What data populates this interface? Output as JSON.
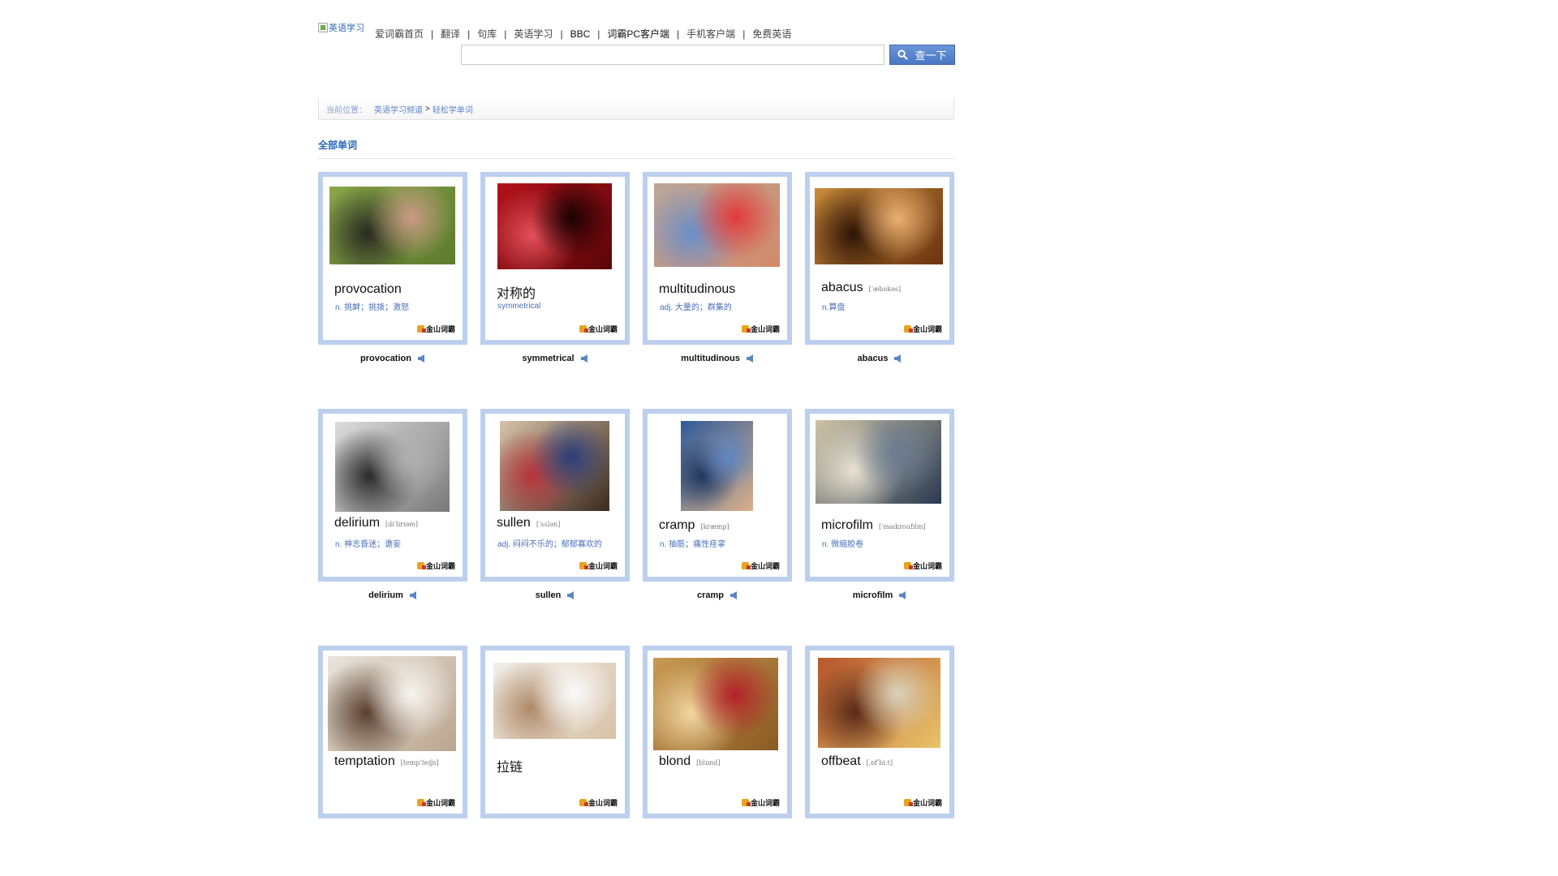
{
  "header": {
    "logo_alt": "英语学习",
    "nav": [
      {
        "label": "爱词霸首页"
      },
      {
        "label": "翻译"
      },
      {
        "label": "句库"
      },
      {
        "label": "英语学习"
      },
      {
        "label": "BBC"
      },
      {
        "label": "词霸PC客户端"
      },
      {
        "label": "手机客户端"
      },
      {
        "label": "免费英语"
      }
    ],
    "search": {
      "value": "",
      "button_label": "查一下"
    }
  },
  "breadcrumb": {
    "label": "当前位置：",
    "channel": "英语学习频道",
    "separator": ">",
    "current": "轻松学单词"
  },
  "section": {
    "title": "全部单词"
  },
  "brand_label": "金山词霸",
  "cards": [
    {
      "word": "provocation",
      "phonetic": "",
      "definition": "n. 挑衅；挑拨；激怒",
      "caption": "provocation",
      "palette": [
        "#8aa84a",
        "#5d7a2e",
        "#2a2a22",
        "#c99a86"
      ]
    },
    {
      "word": "对称的",
      "phonetic": "",
      "definition": "symmetrical",
      "caption": "symmetrical",
      "palette": [
        "#b3121a",
        "#5a0609",
        "#e2505a",
        "#1a0203"
      ]
    },
    {
      "word": "multitudinous",
      "phonetic": "",
      "definition": "adj. 大量的；群集的",
      "caption": "multitudinous",
      "palette": [
        "#b9a79a",
        "#d48a6a",
        "#6b8fc9",
        "#e23a3a"
      ]
    },
    {
      "word": "abacus",
      "phonetic": "[ˈæbəkəs]",
      "definition": "n.算盘",
      "caption": "abacus",
      "palette": [
        "#c98a3a",
        "#6a3410",
        "#2e1506",
        "#e9b072"
      ]
    },
    {
      "word": "delirium",
      "phonetic": "[dɪˈlɪrɪəm]",
      "definition": "n. 神志昏迷；谵妄",
      "caption": "delirium",
      "palette": [
        "#dcdcdc",
        "#7a7a7a",
        "#2a2a2a",
        "#b0b0b0"
      ]
    },
    {
      "word": "sullen",
      "phonetic": "[ˈsʌlən]",
      "definition": "adj. 闷闷不乐的；郁郁寡欢的",
      "caption": "sullen",
      "palette": [
        "#d7c3a8",
        "#3c2a20",
        "#b8333a",
        "#2c3d7a"
      ]
    },
    {
      "word": "cramp",
      "phonetic": "[kræmp]",
      "definition": "n. 抽筋；痛性痉挛",
      "caption": "cramp",
      "palette": [
        "#2f5b9a",
        "#d9b08a",
        "#1c3560",
        "#5f86c0"
      ]
    },
    {
      "word": "microfilm",
      "phonetic": "[ˈmaɪkroufɪlm]",
      "definition": "n. 微缩胶卷",
      "caption": "microfilm",
      "palette": [
        "#cfc3a6",
        "#2a3a52",
        "#e8e2d2",
        "#6b7d92"
      ]
    },
    {
      "word": "temptation",
      "phonetic": "[tempˈteɪʃn]",
      "definition": "",
      "caption": "",
      "palette": [
        "#e9e4dc",
        "#b9a58e",
        "#5a4030",
        "#f7f4ef"
      ]
    },
    {
      "word": "拉链",
      "phonetic": "",
      "definition": "",
      "caption": "",
      "palette": [
        "#f0eee9",
        "#d8c1a6",
        "#b08a6a",
        "#fafafa"
      ]
    },
    {
      "word": "blond",
      "phonetic": "[blɒnd]",
      "definition": "",
      "caption": "",
      "palette": [
        "#c99a52",
        "#8a5a22",
        "#f1d6a2",
        "#b3222a"
      ]
    },
    {
      "word": "offbeat",
      "phonetic": "[ˌɒfˈbi:t]",
      "definition": "",
      "caption": "",
      "palette": [
        "#b8552a",
        "#e8c46a",
        "#5a2a18",
        "#d9d2bc"
      ]
    }
  ]
}
